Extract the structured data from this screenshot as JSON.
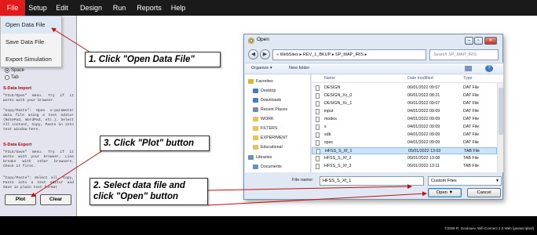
{
  "menubar": {
    "items": [
      {
        "label": "File",
        "active": true
      },
      {
        "label": "Setup"
      },
      {
        "label": "Edit"
      },
      {
        "label": "Design"
      },
      {
        "label": "Run"
      },
      {
        "label": "Reports"
      },
      {
        "label": "Help"
      }
    ]
  },
  "file_menu": {
    "items": [
      {
        "label": "Open Data File",
        "highlighted": true
      },
      {
        "label": "Save Data File"
      },
      {
        "label": "Export Simulation"
      }
    ]
  },
  "left_panel": {
    "radios": [
      {
        "label": "Space",
        "checked": true
      },
      {
        "label": "Tab",
        "checked": false
      }
    ],
    "import_heading": "S-Data Import",
    "import_text_1": "\"FILE/Open\" menu. Try if it works with your browser.",
    "import_text_2": "\"Copy/Paste\": Open s-parameter data file using a text editor (NotePad, WordPad, etc.). Select All content, Copy, Paste in into text window here.",
    "export_heading": "S-Data Export",
    "export_text_1": "\"FILE/Save\" menu. Try if it works with your browser. Line breaks with other browsers. Check it first.",
    "export_text_2": "\"Copy/Paste\": Select all, Copy, Paste into a text editor and Save in plain text format",
    "plot_label": "Plot",
    "clear_label": "Clear"
  },
  "callouts": {
    "step1": "1. Click \"Open Data File\"",
    "step2": "2. Select data file and click \"Open\" button",
    "step3": "3. Click \"Plot\" button"
  },
  "dialog": {
    "title": "Open",
    "address_path": "« WebSites ▸ REV_1_BKUP ▸ SP_MAP_IRIS ▸",
    "search_placeholder": "Search SP_MAP_IRIS",
    "organize_label": "Organize ▾",
    "new_folder_label": "New folder",
    "nav_items": [
      {
        "label": "Favorites",
        "icon": "star-icon",
        "color": "#e0b23a",
        "group": true
      },
      {
        "label": "Desktop",
        "icon": "desktop-icon",
        "color": "#4a79c2"
      },
      {
        "label": "Downloads",
        "icon": "downloads-icon",
        "color": "#4a79c2"
      },
      {
        "label": "Recent Places",
        "icon": "recent-places-icon",
        "color": "#7a8aa0"
      },
      {
        "label": "WORK",
        "icon": "folder-icon",
        "color": "#e8c25a"
      },
      {
        "label": "FILTERS",
        "icon": "folder-icon",
        "color": "#e8c25a"
      },
      {
        "label": "EXPERIMENT",
        "icon": "folder-icon",
        "color": "#e8c25a"
      },
      {
        "label": "Educational",
        "icon": "folder-icon",
        "color": "#e8c25a"
      },
      {
        "label": "Libraries",
        "icon": "libraries-icon",
        "color": "#6e8fb8",
        "group": true
      },
      {
        "label": "Documents",
        "icon": "documents-icon",
        "color": "#6e8fb8"
      },
      {
        "label": "Music",
        "icon": "music-icon",
        "color": "#6e8fb8"
      }
    ],
    "columns": {
      "name": "Name",
      "date": "Date modified",
      "type": "Type"
    },
    "files": [
      {
        "name": "DESIGN",
        "date": "06/01/2022 09:07",
        "type": "DAT File"
      },
      {
        "name": "DESIGN_Xc_0",
        "date": "06/01/2022 08:21",
        "type": "DAT File"
      },
      {
        "name": "DESIGN_Xc_1",
        "date": "06/01/2022 09:07",
        "type": "DAT File"
      },
      {
        "name": "input",
        "date": "04/01/2022 09:09",
        "type": "DAT File"
      },
      {
        "name": "modes",
        "date": "04/01/2022 09:09",
        "type": "DAT File"
      },
      {
        "name": "s",
        "date": "04/01/2022 09:09",
        "type": "DAT File"
      },
      {
        "name": "sdb",
        "date": "04/01/2022 09:09",
        "type": "DAT File"
      },
      {
        "name": "spec",
        "date": "04/01/2022 09:09",
        "type": "DAT File"
      },
      {
        "name": "HFSS_S_Xf_1",
        "date": "05/01/2022 13:03",
        "type": "TAB File",
        "selected": true
      },
      {
        "name": "HFSS_S_Xf_2",
        "date": "05/01/2022 13:08",
        "type": "TAB File"
      },
      {
        "name": "HFSS_S_Xf_3",
        "date": "05/01/2022 13:11",
        "type": "TAB File"
      }
    ],
    "file_name_label": "File name:",
    "file_name_value": "HFSS_S_Xf_1",
    "file_type_value": "Custom Files",
    "open_label": "Open",
    "cancel_label": "Cancel"
  },
  "footer": {
    "credit": "©2006 R. Goulouev, Wifi-Connect 2.0 Web (javascripted)"
  },
  "colors": {
    "menubar_bg": "#1a1a1a",
    "active_menu": "#e21a1a",
    "arrow": "#c41010",
    "selected_row": "#cde3f9"
  }
}
